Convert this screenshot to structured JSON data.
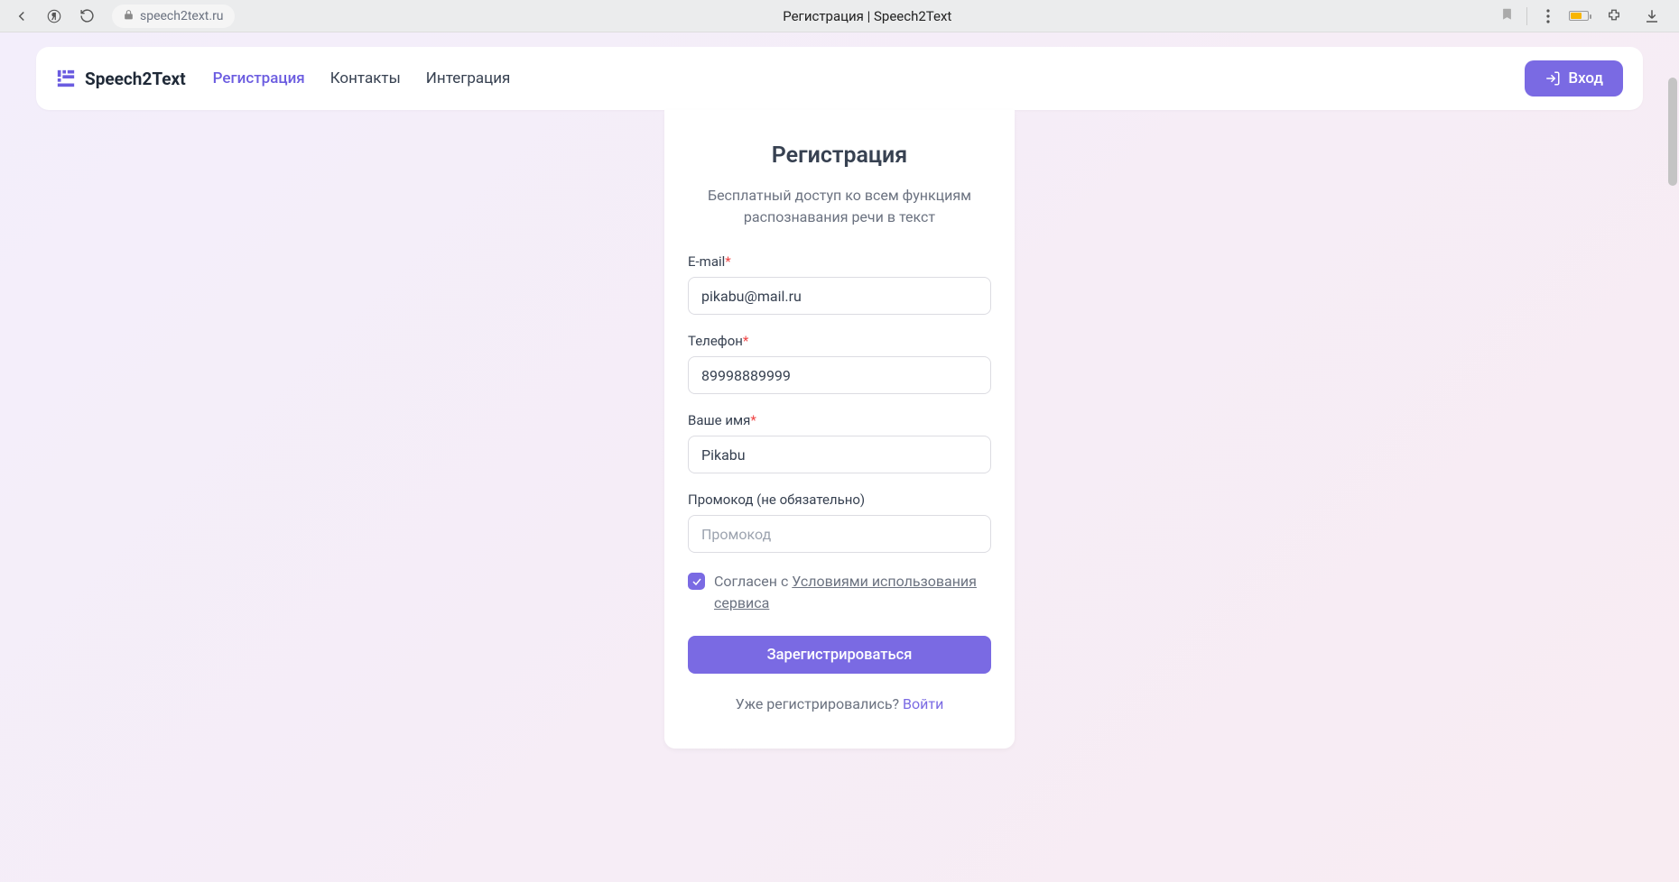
{
  "browser": {
    "url": "speech2text.ru",
    "tab_title": "Регистрация | Speech2Text"
  },
  "nav": {
    "brand": "Speech2Text",
    "links": [
      {
        "label": "Регистрация",
        "active": true
      },
      {
        "label": "Контакты",
        "active": false
      },
      {
        "label": "Интеграция",
        "active": false
      }
    ],
    "login_button": "Вход"
  },
  "form": {
    "title": "Регистрация",
    "subtitle": "Бесплатный доступ ко всем функциям распознавания речи в текст",
    "email_label": "E-mail",
    "email_value": "pikabu@mail.ru",
    "phone_label": "Телефон",
    "phone_value": "89998889999",
    "name_label": "Ваше имя",
    "name_value": "Pikabu",
    "promo_label": "Промокод (не обязательно)",
    "promo_placeholder": "Промокод",
    "promo_value": "",
    "agree_prefix": "Согласен с ",
    "agree_link": "Условиями использования сервиса",
    "submit": "Зарегистрироваться",
    "footer_prefix": "Уже регистрировались? ",
    "footer_link": "Войти"
  },
  "required_marker": "*"
}
